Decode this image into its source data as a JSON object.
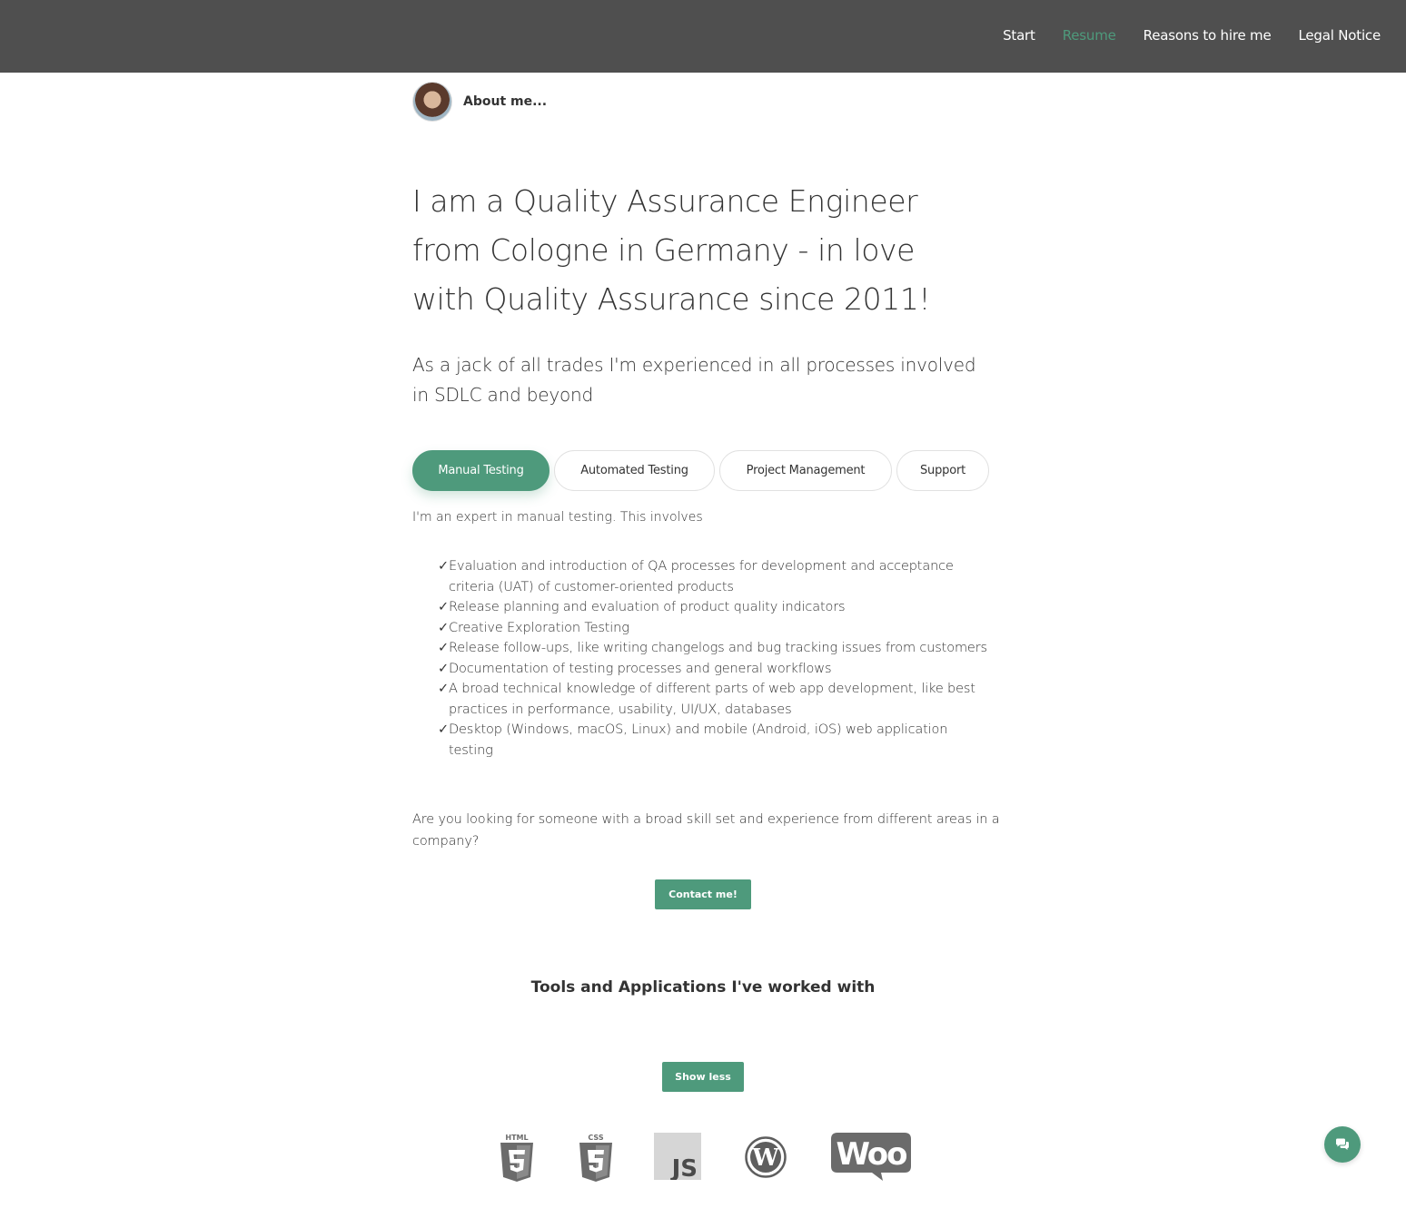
{
  "nav": {
    "items": [
      {
        "label": "Start",
        "active": false
      },
      {
        "label": "Resume",
        "active": true
      },
      {
        "label": "Reasons to hire me",
        "active": false
      },
      {
        "label": "Legal Notice",
        "active": false
      }
    ]
  },
  "about": {
    "title": "About me..."
  },
  "hero": {
    "headline": "I am a Quality Assurance Engineer from Cologne in Germany - in love with Quality Assurance since 2011!",
    "subline": "As a jack of all trades I'm experienced in all processes involved in SDLC and beyond"
  },
  "tabs": [
    {
      "label": "Manual Testing",
      "active": true
    },
    {
      "label": "Automated Testing",
      "active": false
    },
    {
      "label": "Project Management",
      "active": false
    },
    {
      "label": "Support",
      "active": false
    }
  ],
  "content": {
    "intro": "I'm an expert in manual testing. This involves",
    "check_mark": "✓",
    "items": [
      "Evaluation and introduction of QA processes for development and acceptance criteria (UAT) of customer-oriented products",
      "Release planning and evaluation of product quality indicators",
      "Creative Exploration Testing",
      "Release follow-ups, like writing changelogs and bug tracking issues from customers",
      "Documentation of testing processes and general workflows",
      "A broad technical knowledge of different parts of web app development, like best practices in performance, usability, UI/UX, databases",
      "Desktop (Windows, macOS, Linux) and mobile (Android, iOS) web application testing"
    ],
    "question": "Are you looking for someone with a broad skill set and experience from different areas in a company?",
    "contact_label": "Contact me!"
  },
  "tools": {
    "title": "Tools and Applications I've worked with",
    "show_less_label": "Show less",
    "logos": [
      {
        "icon": "html5-icon",
        "label": "HTML"
      },
      {
        "icon": "css3-icon",
        "label": "CSS"
      },
      {
        "icon": "javascript-icon",
        "label": "JS"
      },
      {
        "icon": "wordpress-icon",
        "label": ""
      },
      {
        "icon": "woocommerce-icon",
        "label": "Woo"
      }
    ]
  },
  "colors": {
    "accent": "#4e9a7c",
    "header": "#4f4f4f",
    "logo_gray": "#6b6b6b"
  },
  "chat": {
    "icon": "chat-bubbles-icon"
  }
}
